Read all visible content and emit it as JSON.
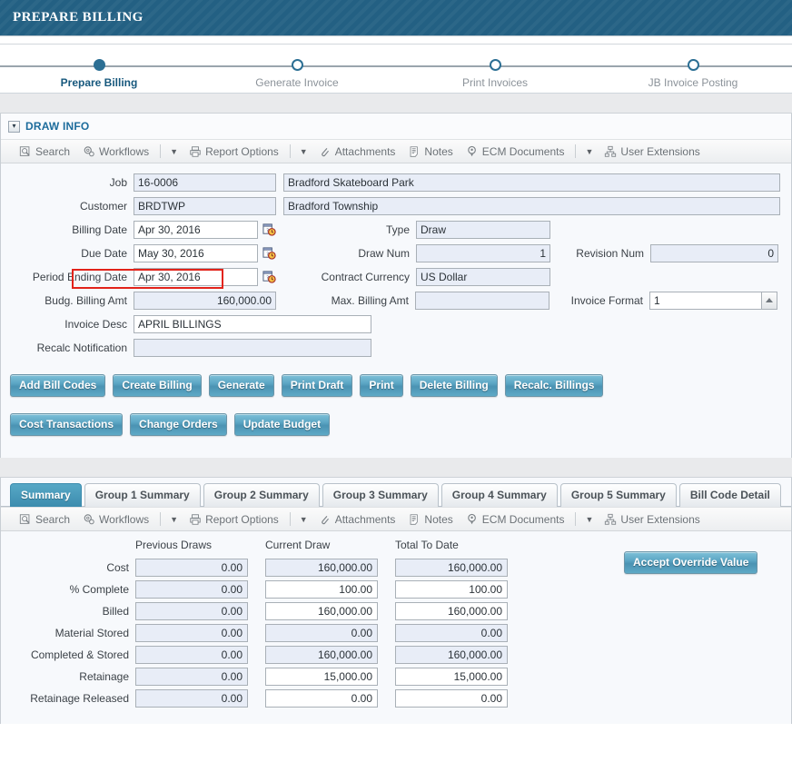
{
  "banner": {
    "title": "PREPARE BILLING"
  },
  "stepper": {
    "steps": [
      {
        "label": "Prepare Billing",
        "active": true
      },
      {
        "label": "Generate Invoice",
        "active": false
      },
      {
        "label": "Print Invoices",
        "active": false
      },
      {
        "label": "JB Invoice Posting",
        "active": false
      }
    ]
  },
  "draw_info": {
    "section_title": "DRAW INFO",
    "toolbar": [
      {
        "label": "Search",
        "icon": "search-icon"
      },
      {
        "label": "Workflows",
        "icon": "workflows-icon"
      },
      {
        "label": "Report Options",
        "icon": "printer-icon",
        "caret_before": true
      },
      {
        "label": "Attachments",
        "icon": "paperclip-icon",
        "caret_before": true
      },
      {
        "label": "Notes",
        "icon": "notes-icon"
      },
      {
        "label": "ECM Documents",
        "icon": "ecm-icon"
      },
      {
        "label": "User Extensions",
        "icon": "user-extensions-icon",
        "caret_before": true
      }
    ],
    "fields": {
      "job_label": "Job",
      "job_value": "16-0006",
      "job_desc_value": "Bradford Skateboard Park",
      "customer_label": "Customer",
      "customer_value": "BRDTWP",
      "customer_desc_value": "Bradford Township",
      "billing_date_label": "Billing Date",
      "billing_date_value": "Apr 30, 2016",
      "due_date_label": "Due Date",
      "due_date_value": "May 30, 2016",
      "period_ending_date_label": "Period Ending Date",
      "period_ending_date_value": "Apr 30, 2016",
      "budg_billing_amt_label": "Budg. Billing Amt",
      "budg_billing_amt_value": "160,000.00",
      "type_label": "Type",
      "type_value": "Draw",
      "draw_num_label": "Draw Num",
      "draw_num_value": "1",
      "contract_currency_label": "Contract Currency",
      "contract_currency_value": "US Dollar",
      "max_billing_amt_label": "Max. Billing Amt",
      "max_billing_amt_value": "",
      "revision_num_label": "Revision Num",
      "revision_num_value": "0",
      "invoice_format_label": "Invoice Format",
      "invoice_format_value": "1",
      "invoice_desc_label": "Invoice Desc",
      "invoice_desc_value": "APRIL BILLINGS",
      "recalc_notification_label": "Recalc Notification",
      "recalc_notification_value": ""
    },
    "buttons_row1": [
      "Add Bill Codes",
      "Create Billing",
      "Generate",
      "Print Draft",
      "Print",
      "Delete Billing",
      "Recalc. Billings"
    ],
    "buttons_row2": [
      "Cost Transactions",
      "Change Orders",
      "Update Budget"
    ]
  },
  "tabs": [
    {
      "label": "Summary",
      "active": true
    },
    {
      "label": "Group 1 Summary",
      "active": false
    },
    {
      "label": "Group 2 Summary",
      "active": false
    },
    {
      "label": "Group 3 Summary",
      "active": false
    },
    {
      "label": "Group 4 Summary",
      "active": false
    },
    {
      "label": "Group 5 Summary",
      "active": false
    },
    {
      "label": "Bill Code Detail",
      "active": false
    }
  ],
  "summary": {
    "toolbar": [
      {
        "label": "Search",
        "icon": "search-icon"
      },
      {
        "label": "Workflows",
        "icon": "workflows-icon"
      },
      {
        "label": "Report Options",
        "icon": "printer-icon",
        "caret_before": true
      },
      {
        "label": "Attachments",
        "icon": "paperclip-icon",
        "caret_before": true
      },
      {
        "label": "Notes",
        "icon": "notes-icon"
      },
      {
        "label": "ECM Documents",
        "icon": "ecm-icon"
      },
      {
        "label": "User Extensions",
        "icon": "user-extensions-icon",
        "caret_before": true
      }
    ],
    "columns": [
      "Previous Draws",
      "Current Draw",
      "Total To Date"
    ],
    "rows": [
      {
        "label": "Cost",
        "values": [
          "0.00",
          "160,000.00",
          "160,000.00"
        ],
        "readonly": [
          true,
          true,
          true
        ]
      },
      {
        "label": "% Complete",
        "values": [
          "0.00",
          "100.00",
          "100.00"
        ],
        "readonly": [
          true,
          false,
          false
        ]
      },
      {
        "label": "Billed",
        "values": [
          "0.00",
          "160,000.00",
          "160,000.00"
        ],
        "readonly": [
          true,
          false,
          false
        ]
      },
      {
        "label": "Material Stored",
        "values": [
          "0.00",
          "0.00",
          "0.00"
        ],
        "readonly": [
          true,
          true,
          true
        ]
      },
      {
        "label": "Completed & Stored",
        "values": [
          "0.00",
          "160,000.00",
          "160,000.00"
        ],
        "readonly": [
          true,
          true,
          true
        ]
      },
      {
        "label": "Retainage",
        "values": [
          "0.00",
          "15,000.00",
          "15,000.00"
        ],
        "readonly": [
          true,
          false,
          false
        ]
      },
      {
        "label": "Retainage Released",
        "values": [
          "0.00",
          "0.00",
          "0.00"
        ],
        "readonly": [
          true,
          false,
          false
        ]
      }
    ],
    "accept_override_label": "Accept Override Value"
  },
  "colors": {
    "banner": "#236083",
    "accent": "#2c6f94",
    "button": "#5ba6c4",
    "annotation": "#e2231a",
    "readonly_field": "#e8edf7"
  }
}
